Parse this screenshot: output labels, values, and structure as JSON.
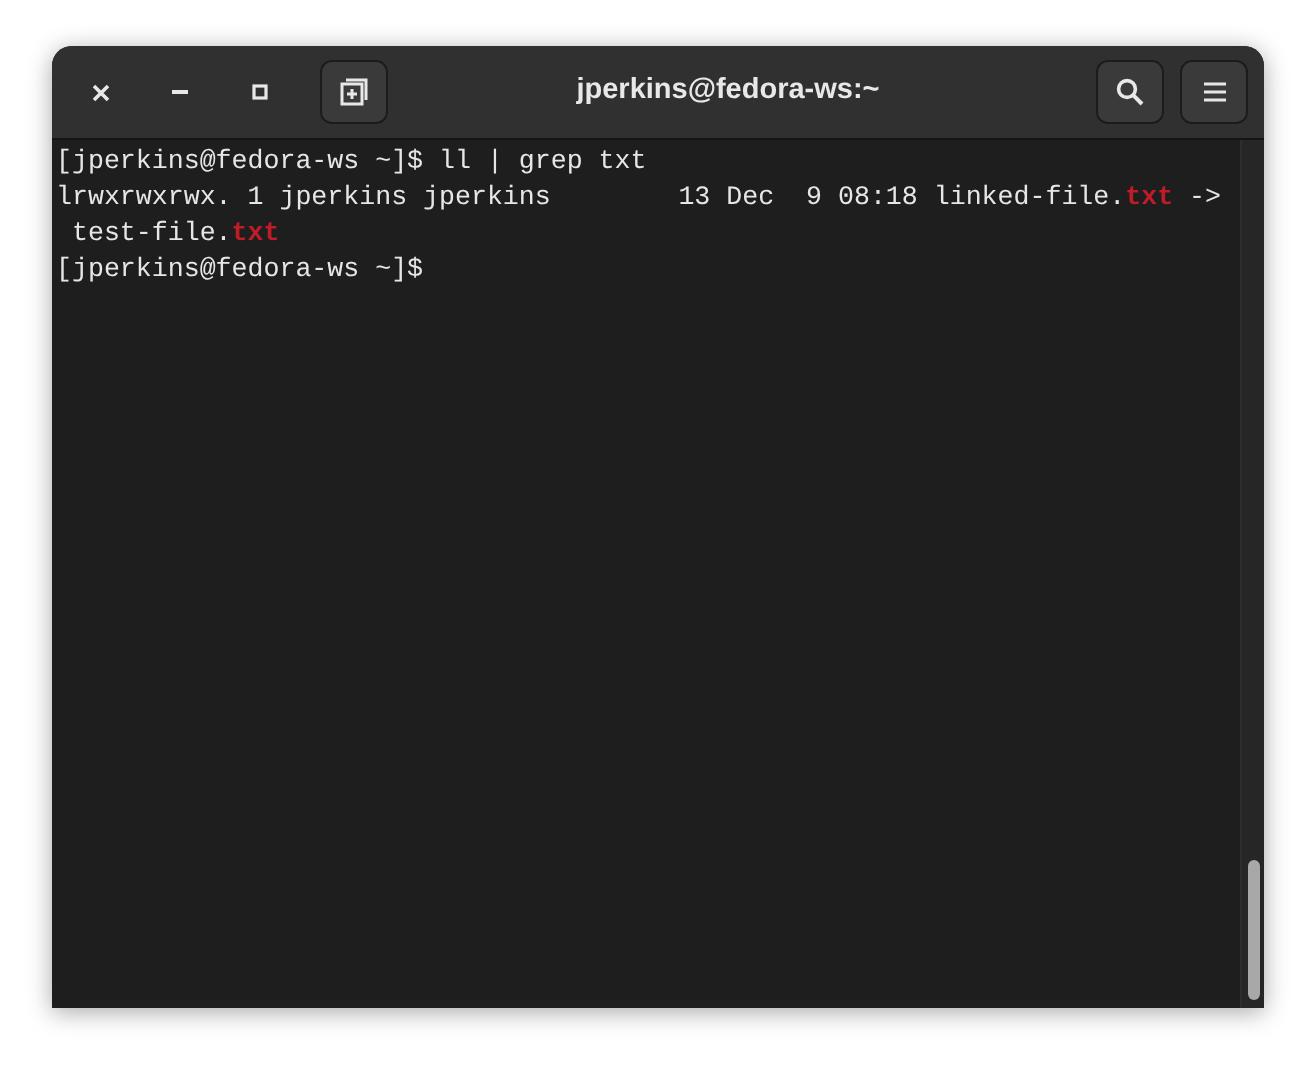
{
  "window": {
    "title": "jperkins@fedora-ws:~"
  },
  "terminal": {
    "lines": [
      [
        {
          "kind": "plain",
          "text": "[jperkins@fedora-ws ~]$ ll | grep txt"
        }
      ],
      [
        {
          "kind": "plain",
          "text": "lrwxrwxrwx. 1 jperkins jperkins        13 Dec  9 08:18 linked-file."
        },
        {
          "kind": "match",
          "text": "txt"
        },
        {
          "kind": "plain",
          "text": " ->"
        }
      ],
      [
        {
          "kind": "plain",
          "text": " test-file."
        },
        {
          "kind": "match",
          "text": "txt"
        }
      ],
      [
        {
          "kind": "plain",
          "text": "[jperkins@fedora-ws ~]$"
        }
      ]
    ]
  }
}
